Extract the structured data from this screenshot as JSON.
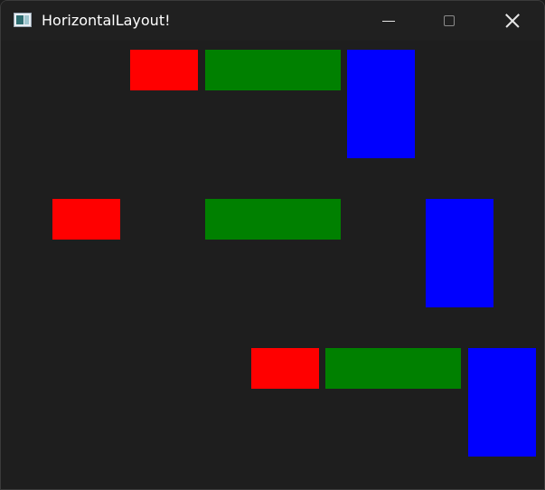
{
  "window": {
    "title": "HorizontalLayout!",
    "icon": "app-window-icon"
  },
  "controls": {
    "minimize_icon": "minimize-icon",
    "maximize_icon": "maximize-icon",
    "close_icon": "close-icon"
  },
  "colors": {
    "red": "#ff0000",
    "green": "#008000",
    "blue": "#0000ff",
    "background": "#1e1e1e",
    "titlebar": "#202020"
  },
  "rows": [
    {
      "items": [
        "red",
        "green",
        "blue"
      ]
    },
    {
      "items": [
        "red",
        "green",
        "blue"
      ]
    },
    {
      "items": [
        "red",
        "green",
        "blue"
      ]
    }
  ]
}
